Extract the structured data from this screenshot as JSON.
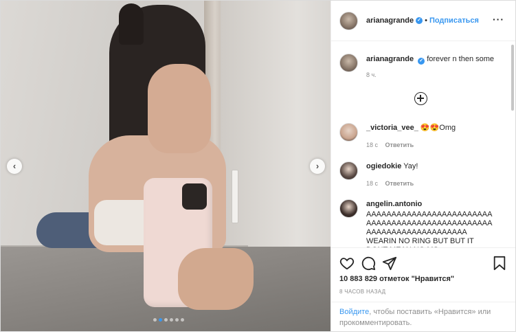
{
  "photo": {
    "prev_arrow": "‹",
    "next_arrow": "›",
    "carousel": {
      "count": 6,
      "active": 1
    }
  },
  "header": {
    "username": "arianagrande",
    "verified_mark": "✓",
    "separator": "•",
    "follow_label": "Подписаться",
    "more_label": "···"
  },
  "caption": {
    "username": "arianagrande",
    "verified_mark": "✓",
    "text": "forever n then some",
    "time": "8 ч."
  },
  "load_more_icon": "circle-plus-icon",
  "comments": [
    {
      "username": "_victoria_vee_",
      "text": "😍😍Omg",
      "time": "18 с",
      "reply_label": "Ответить",
      "avatar_color": "#c9a48e"
    },
    {
      "username": "ogiedokie",
      "text": "Yay!",
      "time": "18 с",
      "reply_label": "Ответить",
      "avatar_color": "#5a4a44"
    },
    {
      "username": "angelin.antonio",
      "text": "AAAAAAAAAAAAAAAAAAAAAAAAAAAAAAAAAAAAAAAAAAAAAAAAAAAAAAAAAAAAAAAAAAAAAA WEARIN NO RING BUT BUT IT DONT MEAN NO MS.",
      "avatar_color": "#3d2f2b"
    }
  ],
  "actions": {
    "icons": [
      "heart-icon",
      "comment-icon",
      "share-icon",
      "bookmark-icon"
    ],
    "likes_text": "10 883 829 отметок \"Нравится\"",
    "time_ago": "8 ЧАСОВ НАЗАД"
  },
  "login_prompt": {
    "link": "Войдите",
    "rest": ", чтобы поставить «Нравится» или прокомментировать."
  }
}
